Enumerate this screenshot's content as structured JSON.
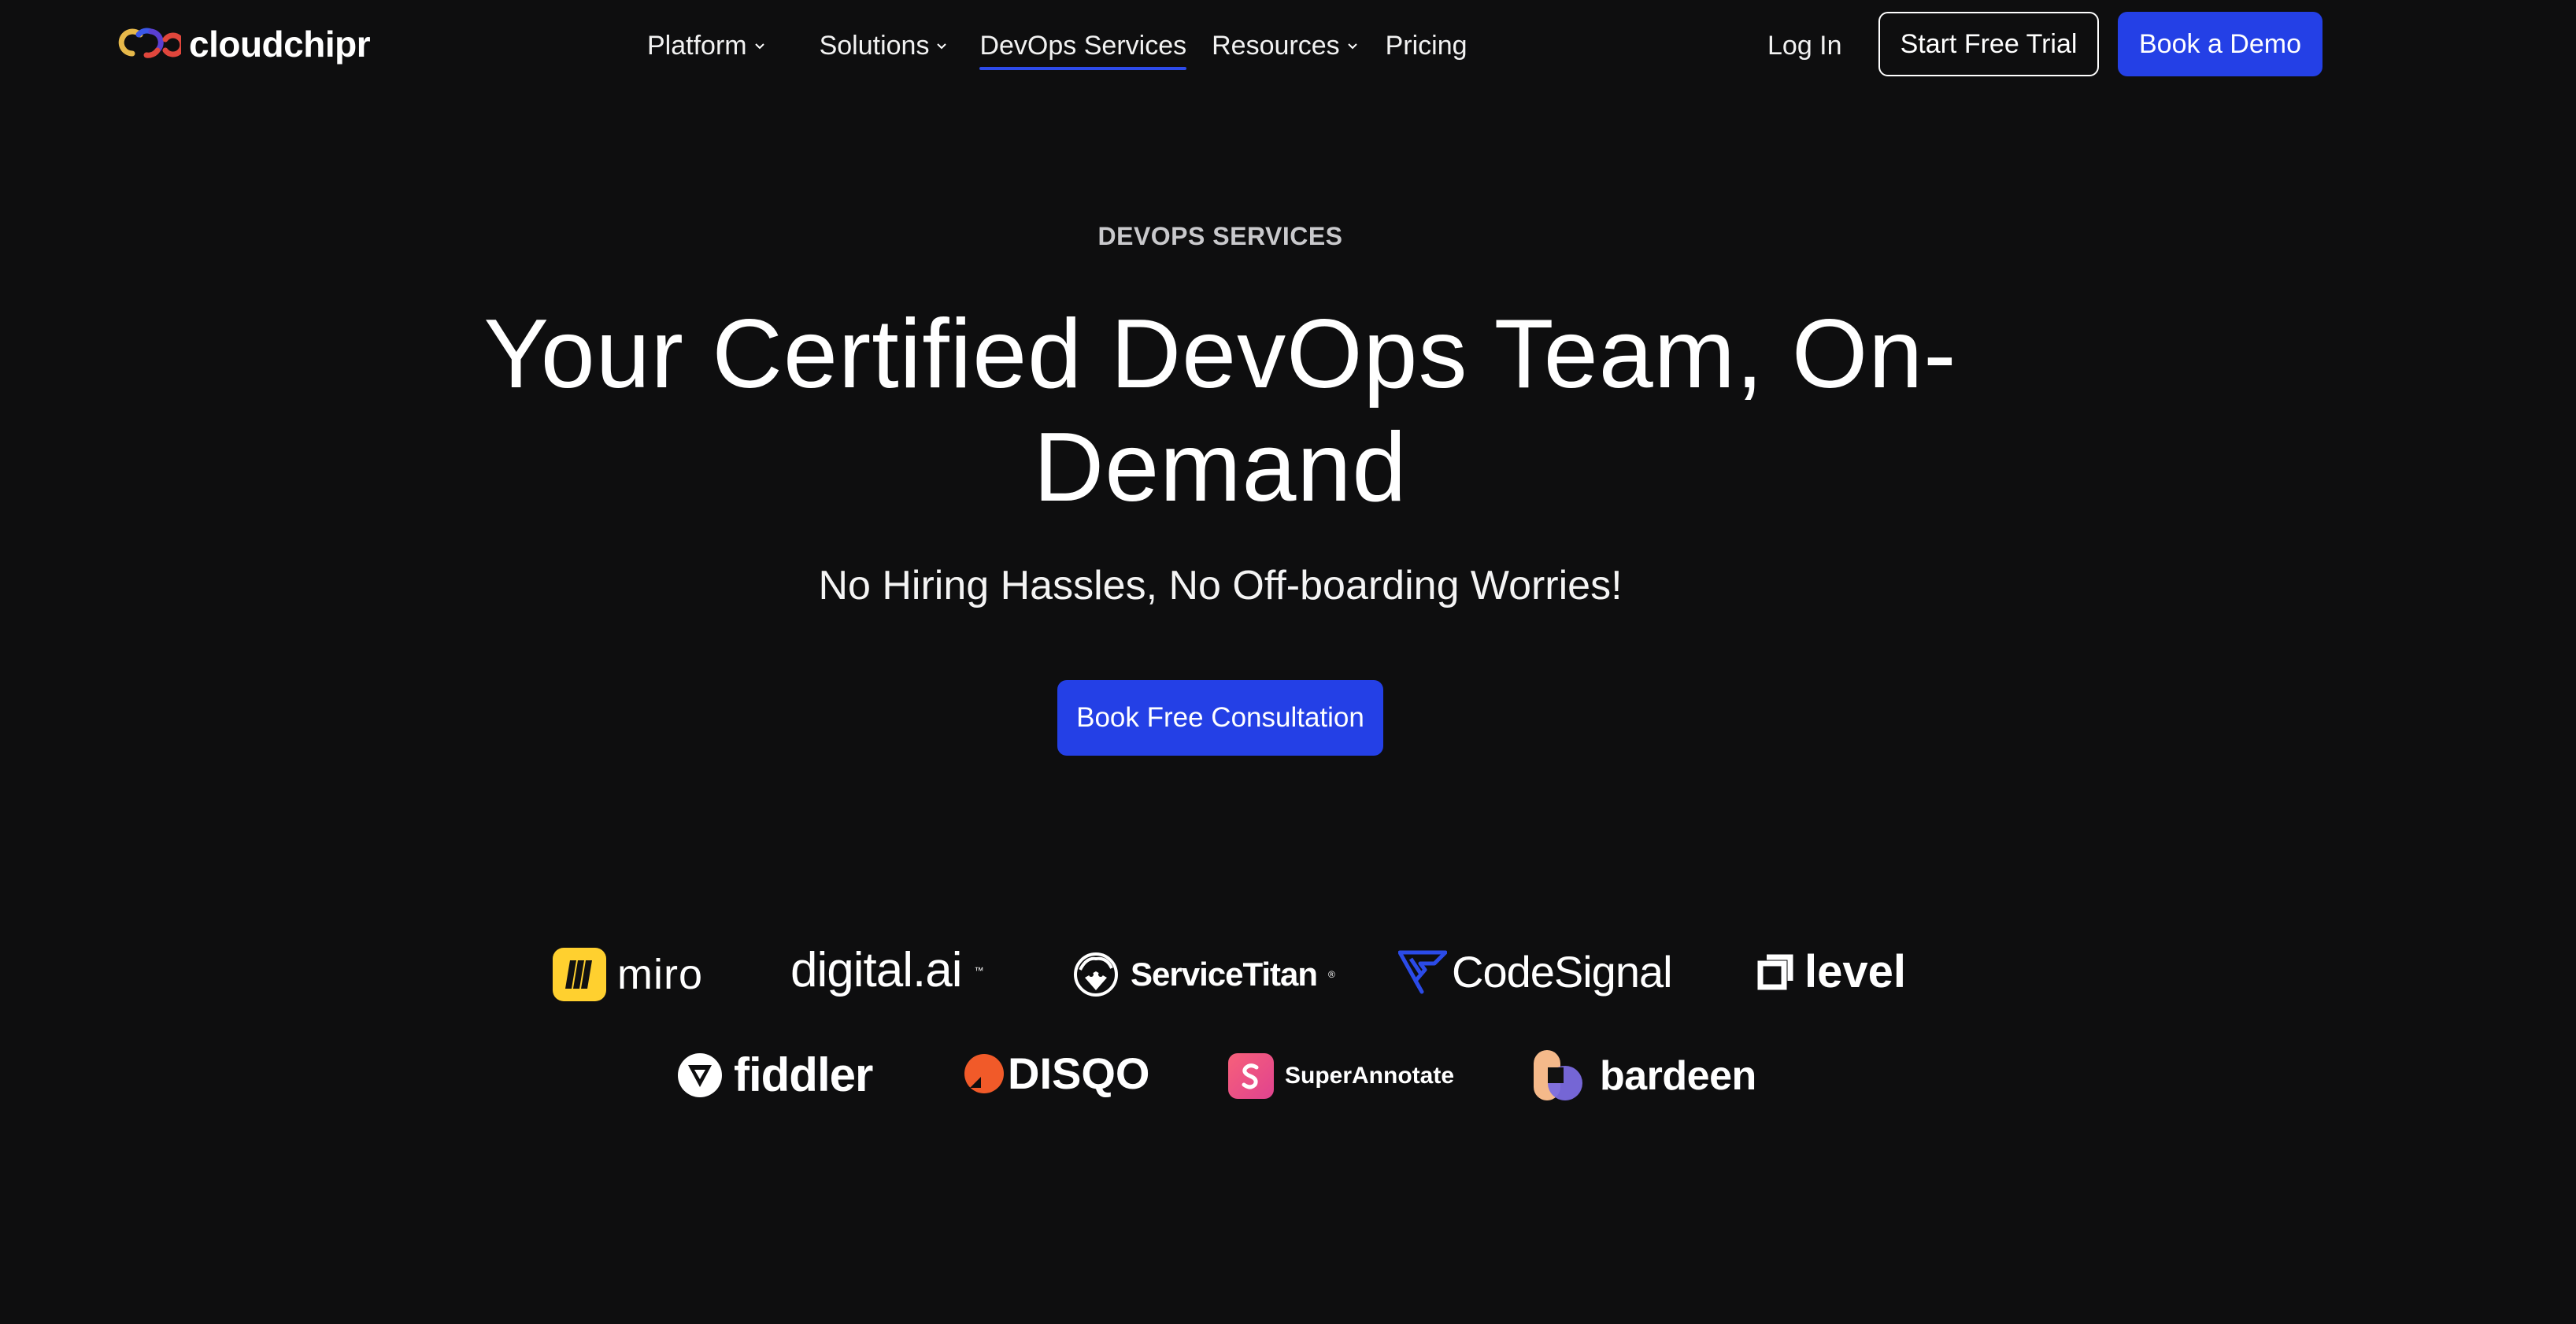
{
  "brand": {
    "name": "cloudchipr"
  },
  "nav": {
    "items": [
      {
        "label": "Platform",
        "has_dropdown": true,
        "active": false
      },
      {
        "label": "Solutions",
        "has_dropdown": true,
        "active": false
      },
      {
        "label": "DevOps Services",
        "has_dropdown": false,
        "active": true
      },
      {
        "label": "Resources",
        "has_dropdown": true,
        "active": false
      },
      {
        "label": "Pricing",
        "has_dropdown": false,
        "active": false
      }
    ],
    "login_label": "Log In",
    "trial_label": "Start Free Trial",
    "demo_label": "Book a Demo"
  },
  "hero": {
    "eyebrow": "DEVOPS SERVICES",
    "headline": "Your Certified DevOps Team, On-Demand",
    "subheadline": "No Hiring Hassles, No Off-boarding Worries!",
    "cta_label": "Book Free Consultation"
  },
  "logos": {
    "row1": [
      {
        "name": "miro",
        "icon": "miro-logo-mark"
      },
      {
        "name": "digital.ai",
        "icon": "digitalai-wordmark"
      },
      {
        "name": "ServiceTitan",
        "icon": "servicetitan-lion-mark"
      },
      {
        "name": "CodeSignal",
        "icon": "codesignal-logo-mark"
      },
      {
        "name": "level",
        "icon": "level-logo-mark"
      }
    ],
    "row2": [
      {
        "name": "fiddler",
        "icon": "fiddler-logo-mark"
      },
      {
        "name": "DISQO",
        "icon": "disqo-logo-mark"
      },
      {
        "name": "SuperAnnotate",
        "icon": "superannotate-logo-mark"
      },
      {
        "name": "bardeen",
        "icon": "bardeen-logo-mark"
      }
    ]
  },
  "colors": {
    "background": "#0e0e0f",
    "accent": "#2440e6",
    "text": "#ffffff",
    "eyebrow": "#c9c9cc",
    "miro_yellow": "#ffd02f",
    "disqo_orange": "#f15a29",
    "superannotate_pink": "#f0506e",
    "codesignal_blue": "#2b4be8"
  }
}
